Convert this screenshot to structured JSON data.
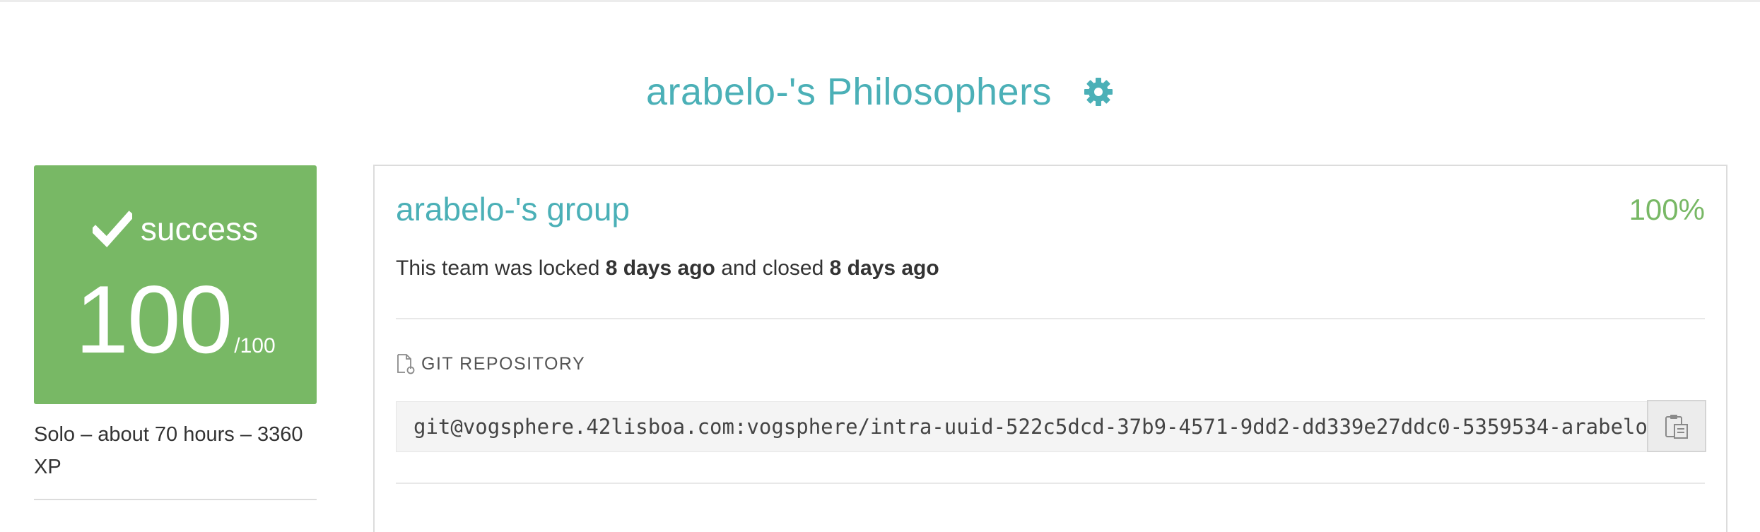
{
  "header": {
    "title": "arabelo-'s Philosophers",
    "settings_icon": "gear-icon"
  },
  "result": {
    "status_icon": "check-icon",
    "status": "success",
    "score": "100",
    "score_max": "/100"
  },
  "meta": {
    "summary": "Solo – about 70 hours – 3360 XP"
  },
  "team": {
    "name": "arabelo-'s group",
    "percent": "100%",
    "status_prefix": "This team was locked ",
    "locked_time": "8 days ago",
    "status_middle": " and closed ",
    "closed_time": "8 days ago"
  },
  "repository": {
    "icon": "document-icon",
    "label": "GIT REPOSITORY",
    "url": "git@vogsphere.42lisboa.com:vogsphere/intra-uuid-522c5dcd-37b9-4571-9dd2-dd339e27ddc0-5359534-arabelo-",
    "copy_icon": "clipboard-icon"
  },
  "colors": {
    "accent_teal": "#4bb0b7",
    "success_green": "#78b865"
  }
}
